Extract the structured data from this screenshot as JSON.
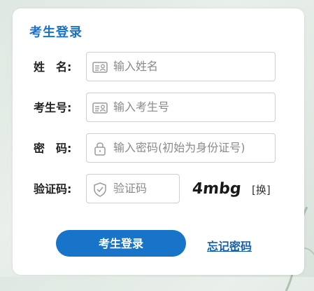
{
  "form": {
    "title": "考生登录",
    "name": {
      "label": "姓　名:",
      "placeholder": "输入姓名",
      "icon": "id-card-icon"
    },
    "exam_no": {
      "label": "考生号:",
      "placeholder": "输入考生号",
      "icon": "id-card-icon"
    },
    "password": {
      "label": "密　码:",
      "placeholder": "输入密码(初始为身份证号)",
      "icon": "lock-icon"
    },
    "captcha": {
      "label": "验证码:",
      "placeholder": "验证码",
      "icon": "shield-icon",
      "image_text": "4mbg",
      "swap_label": "[换]"
    },
    "login_button": "考生登录",
    "forgot_link": "忘记密码"
  },
  "colors": {
    "accent": "#1874c9",
    "title": "#1a73c8",
    "link": "#1660b0"
  }
}
